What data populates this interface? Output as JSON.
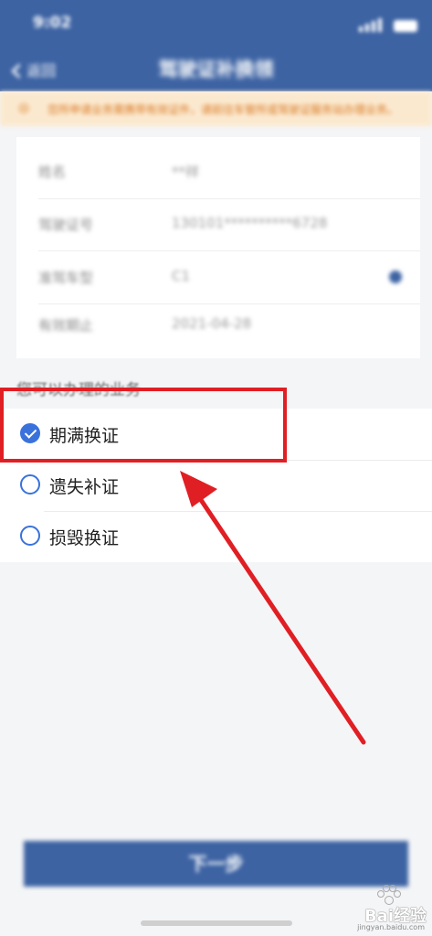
{
  "status_bar": {
    "time": "9:02"
  },
  "nav": {
    "back_label": "返回",
    "title": "驾驶证补换领"
  },
  "notice": {
    "text": "您所申请业务需携带有效证件，请前往车管所或驾驶证服务站办理业务。"
  },
  "license_info": [
    {
      "label": "姓名",
      "value": "**祥"
    },
    {
      "label": "驾驶证号",
      "value": "130101**********6728"
    },
    {
      "label": "准驾车型",
      "value": "C1"
    },
    {
      "label": "有效期止",
      "value": "2021-04-28"
    }
  ],
  "services": {
    "section_label": "您可以办理的业务",
    "options": [
      {
        "label": "期满换证",
        "checked": true
      },
      {
        "label": "遗失补证",
        "checked": false
      },
      {
        "label": "损毁换证",
        "checked": false
      }
    ]
  },
  "next_button": {
    "label": "下一步"
  },
  "watermark": {
    "text": "Bai经验",
    "sub": "jingyan.baidu.com"
  },
  "colors": {
    "primary": "#3d63a3",
    "accent": "#3a72dc",
    "annotation_red": "#e01f24",
    "notice_bg": "#fbe9cf"
  }
}
